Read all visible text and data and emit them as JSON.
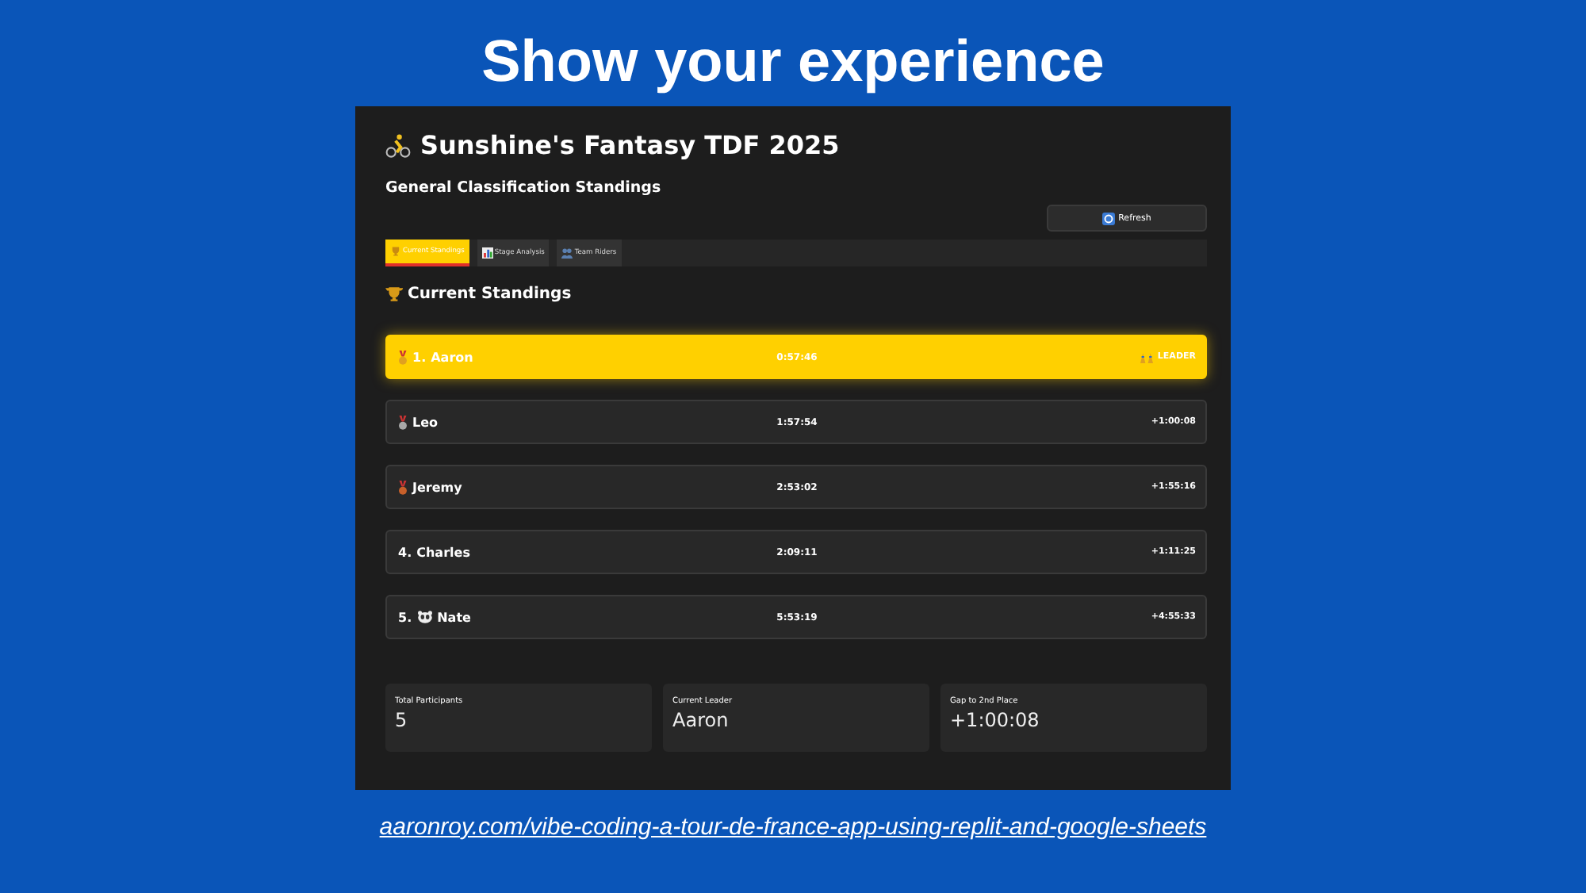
{
  "slide": {
    "title": "Show your experience",
    "link": "aaronroy.com/vibe-coding-a-tour-de-france-app-using-replit-and-google-sheets"
  },
  "app": {
    "title": "Sunshine's Fantasy TDF 2025",
    "subtitle": "General Classification Standings",
    "refresh_button": "Refresh",
    "tabs": [
      {
        "label": "Current Standings",
        "kind": "trophy",
        "selected": true
      },
      {
        "label": "Stage Analysis",
        "kind": "chart",
        "selected": false
      },
      {
        "label": "Team Riders",
        "kind": "people",
        "selected": false
      }
    ],
    "section_title": "Current Standings",
    "standings": [
      {
        "kind": "medal",
        "color": "#e0a020",
        "rank": "1.",
        "name": "Aaron",
        "time": "0:57:46",
        "gap": "LEADER",
        "highlighted": true
      },
      {
        "kind": "medal",
        "color": "#a8a8a8",
        "name": "Leo",
        "time": "1:57:54",
        "gap": "+1:00:08",
        "highlighted": false
      },
      {
        "kind": "medal",
        "color": "#c8602a",
        "name": "Jeremy",
        "time": "2:53:02",
        "gap": "+1:55:16",
        "highlighted": false
      },
      {
        "kind": "plain",
        "rank": "4.",
        "name": "Charles",
        "time": "2:09:11",
        "gap": "+1:11:25",
        "highlighted": false
      },
      {
        "kind": "animal",
        "rank": "5.",
        "name": "Nate",
        "time": "5:53:19",
        "gap": "+4:55:33",
        "highlighted": false
      }
    ],
    "metrics": [
      {
        "label": "Total Participants",
        "value": "5"
      },
      {
        "label": "Current Leader",
        "value": "Aaron"
      },
      {
        "label": "Gap to 2nd Place",
        "value": "+1:00:08"
      }
    ]
  }
}
